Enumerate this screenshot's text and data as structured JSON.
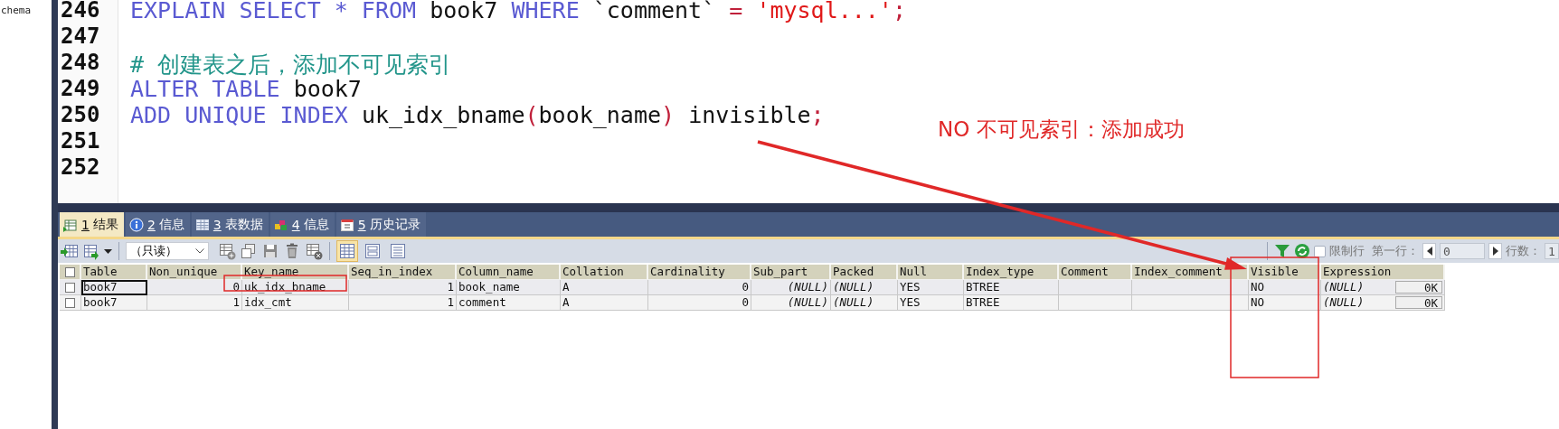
{
  "sidebar": {
    "text": "chema"
  },
  "editor": {
    "lines": [
      {
        "number": "246",
        "tokens": [
          {
            "kind": "keyword",
            "text": "EXPLAIN SELECT * FROM "
          },
          {
            "kind": "plain",
            "text": "book7 "
          },
          {
            "kind": "keyword",
            "text": "WHERE "
          },
          {
            "kind": "plain",
            "text": "`comment` "
          },
          {
            "kind": "operator",
            "text": "= "
          },
          {
            "kind": "string",
            "text": "'mysql...'"
          },
          {
            "kind": "operator",
            "text": ";"
          }
        ]
      },
      {
        "number": "247"
      },
      {
        "number": "248",
        "tokens": [
          {
            "kind": "comment",
            "text": "# 创建表之后，添加不可见索引"
          }
        ]
      },
      {
        "number": "249",
        "tokens": [
          {
            "kind": "keyword",
            "text": "ALTER TABLE "
          },
          {
            "kind": "plain",
            "text": "book7"
          }
        ]
      },
      {
        "number": "250",
        "tokens": [
          {
            "kind": "keyword",
            "text": "ADD UNIQUE INDEX "
          },
          {
            "kind": "plain",
            "text": "uk_idx_bname"
          },
          {
            "kind": "operator",
            "text": "("
          },
          {
            "kind": "plain",
            "text": "book_name"
          },
          {
            "kind": "operator",
            "text": ")"
          },
          {
            "kind": "plain",
            "text": " invisible"
          },
          {
            "kind": "operator",
            "text": ";"
          }
        ]
      },
      {
        "number": "251"
      },
      {
        "number": "252"
      }
    ]
  },
  "results": {
    "tabs": [
      {
        "kind": "results",
        "key": "1",
        "label": "结果",
        "selected": true
      },
      {
        "kind": "info",
        "key": "2",
        "label": "信息",
        "selected": false
      },
      {
        "kind": "table",
        "key": "3",
        "label": "表数据",
        "selected": false
      },
      {
        "kind": "profile",
        "key": "4",
        "label": "信息",
        "selected": false
      },
      {
        "kind": "history",
        "key": "5",
        "label": "历史记录",
        "selected": false
      }
    ],
    "toolbar": {
      "mode": "（只读）",
      "views": [
        {
          "kind": "grid",
          "selected": true
        },
        {
          "kind": "form",
          "selected": false
        },
        {
          "kind": "text",
          "selected": false
        }
      ],
      "limit_rows": {
        "label": "限制行",
        "checked": false
      },
      "first_row": {
        "label": "第一行：",
        "value": "0"
      },
      "row_count": {
        "label": "行数：",
        "value": "1"
      }
    },
    "all_checked": false,
    "columns": [
      {
        "label": "Table",
        "kind": "text"
      },
      {
        "label": "Non_unique",
        "kind": "number"
      },
      {
        "label": "Key_name",
        "kind": "text"
      },
      {
        "label": "Seq_in_index",
        "kind": "number"
      },
      {
        "label": "Column_name",
        "kind": "text"
      },
      {
        "label": "Collation",
        "kind": "text"
      },
      {
        "label": "Cardinality",
        "kind": "number"
      },
      {
        "label": "Sub_part",
        "kind": "number"
      },
      {
        "label": "Packed",
        "kind": "text"
      },
      {
        "label": "Null",
        "kind": "text"
      },
      {
        "label": "Index_type",
        "kind": "text"
      },
      {
        "label": "Comment",
        "kind": "text"
      },
      {
        "label": "Index_comment",
        "kind": "text"
      },
      {
        "label": "Visible",
        "kind": "text"
      },
      {
        "label": "Expression",
        "kind": "text"
      }
    ],
    "rows": [
      {
        "checked": false,
        "size": "0K",
        "cells": [
          {
            "text": "book7",
            "focused": true
          },
          "0",
          "uk_idx_bname",
          "1",
          "book_name",
          "A",
          "0",
          {
            "text": "(NULL)",
            "kind": "null"
          },
          {
            "text": "(NULL)",
            "kind": "null"
          },
          "YES",
          "BTREE",
          null,
          null,
          "NO",
          {
            "text": "(NULL)",
            "kind": "null"
          }
        ]
      },
      {
        "checked": false,
        "size": "0K",
        "cells": [
          "book7",
          "1",
          "idx_cmt",
          "1",
          "comment",
          "A",
          "0",
          {
            "text": "(NULL)",
            "kind": "null"
          },
          {
            "text": "(NULL)",
            "kind": "null"
          },
          "YES",
          "BTREE",
          null,
          null,
          "NO",
          {
            "text": "(NULL)",
            "kind": "null"
          }
        ]
      }
    ]
  },
  "annotation": {
    "text": "NO 不可见索引：添加成功"
  }
}
